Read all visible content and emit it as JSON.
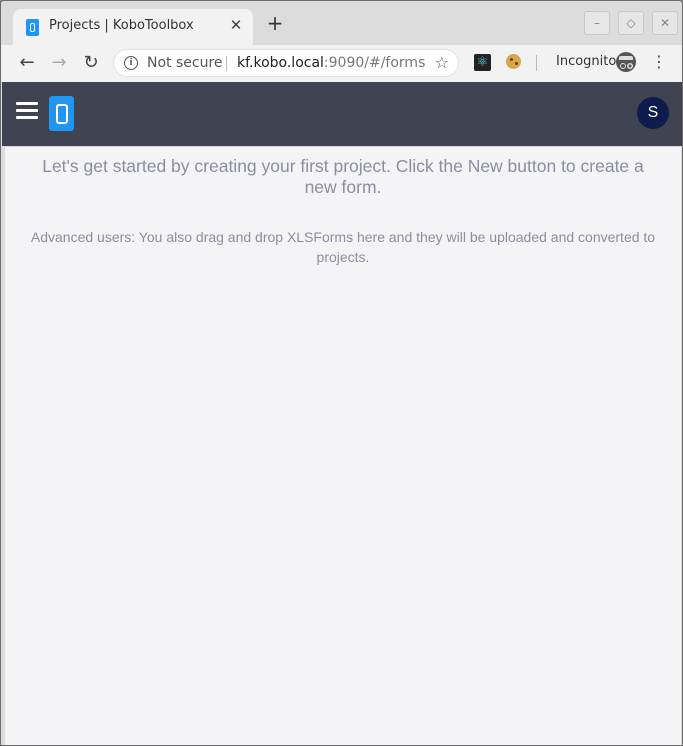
{
  "browser": {
    "tab": {
      "title": "Projects | KoboToolbox",
      "favicon": "kobo-logo-icon"
    },
    "new_tab_label": "+",
    "window_buttons": [
      "–",
      "◇",
      "✕"
    ],
    "address_bar": {
      "security_label": "Not secure",
      "url_host": "kf.kobo.local",
      "url_rest": ":9090/#/forms"
    },
    "extensions": [
      "react-devtools-icon",
      "cookie-icon"
    ],
    "incognito_label": "Incognito"
  },
  "app": {
    "brand_color": "#2095f2",
    "header_color": "#3f4352",
    "avatar_initial": "S"
  },
  "main": {
    "empty_title": "Let's get started by creating your first project. Click the New button to create a new form.",
    "empty_hint": "Advanced users: You also drag and drop XLSForms here and they will be uploaded and converted to projects."
  }
}
